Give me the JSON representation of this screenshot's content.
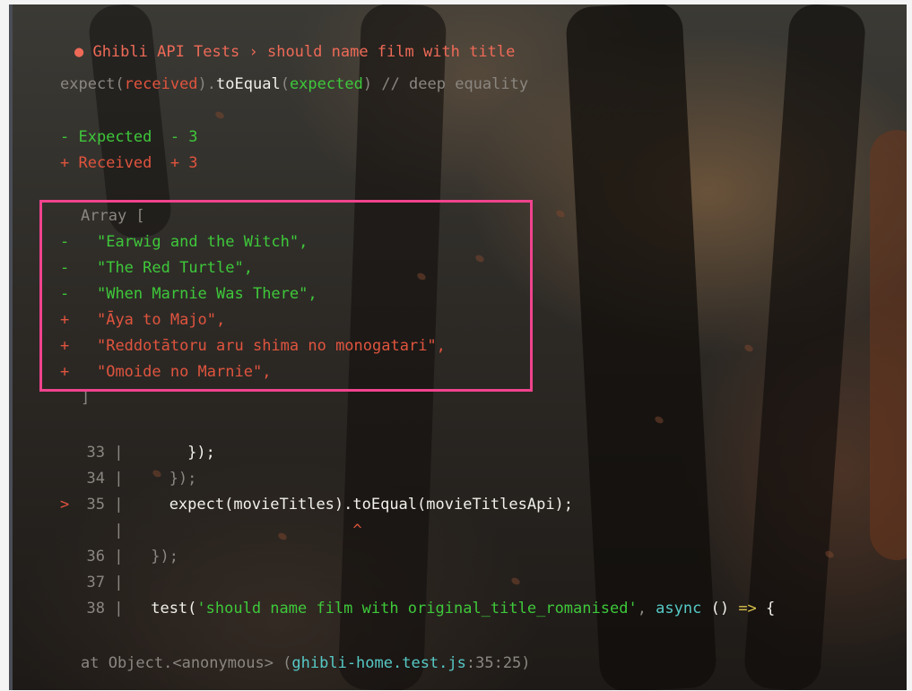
{
  "header": {
    "bullet": "●",
    "suite": "Ghibli API Tests",
    "separator": "›",
    "test_name": "should name film with title"
  },
  "assertion": {
    "prefix": "expect(",
    "received": "received",
    "middle": ").",
    "matcher": "toEqual",
    "open": "(",
    "expected": "expected",
    "close": ")",
    "comment": "// deep equality"
  },
  "diff_summary": {
    "expected_label": "- Expected  - 3",
    "received_label": "+ Received  + 3"
  },
  "diff": {
    "open": "Array [",
    "lines": [
      {
        "sign": "-",
        "text": "\"Earwig and the Witch\","
      },
      {
        "sign": "-",
        "text": "\"The Red Turtle\","
      },
      {
        "sign": "-",
        "text": "\"When Marnie Was There\","
      },
      {
        "sign": "+",
        "text": "\"Āya to Majo\","
      },
      {
        "sign": "+",
        "text": "\"Reddotātoru aru shima no monogatari\","
      },
      {
        "sign": "+",
        "text": "\"Omoide no Marnie\","
      }
    ],
    "close": "]"
  },
  "code_frame": [
    {
      "marker": "",
      "num": "33",
      "bar": "|",
      "code": "      });"
    },
    {
      "marker": "",
      "num": "34",
      "bar": "|",
      "code": "    });"
    },
    {
      "marker": ">",
      "num": "35",
      "bar": "|",
      "code": "    expect(movieTitles).toEqual(movieTitlesApi);"
    },
    {
      "marker": "",
      "num": "",
      "bar": "|",
      "code": "                        ^"
    },
    {
      "marker": "",
      "num": "36",
      "bar": "|",
      "code": "  });"
    },
    {
      "marker": "",
      "num": "37",
      "bar": "|",
      "code": ""
    },
    {
      "marker": "",
      "num": "38",
      "bar": "|",
      "code_a": "  test(",
      "code_str": "'should name film with original_title_romanised'",
      "code_b": ", ",
      "code_kw": "async",
      "code_c": " () ",
      "code_arrow": "=>",
      "code_d": " {"
    }
  ],
  "stack": {
    "prefix": "at Object.<anonymous> (",
    "file": "ghibli-home.test.js",
    "location": ":35:25",
    "suffix": ")"
  },
  "colors": {
    "error_red": "#e0543e",
    "diff_green": "#3ec83a",
    "highlight_pink": "#f0438d",
    "path_cyan": "#56c9c6"
  }
}
